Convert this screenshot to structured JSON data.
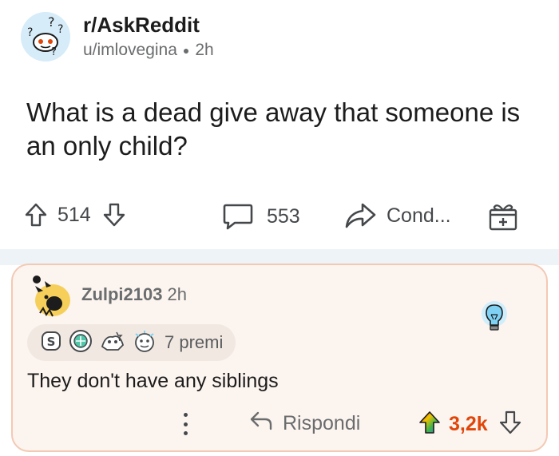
{
  "post": {
    "subreddit": "r/AskReddit",
    "author": "u/imlovegina",
    "time": "2h",
    "title": "What is a dead give away that someone is an only child?",
    "actions": {
      "upvote_icon": "arrow-up-icon",
      "score": "514",
      "downvote_icon": "arrow-down-icon",
      "comment_icon": "chat-bubble-icon",
      "comment_count": "553",
      "share_icon": "share-arrow-icon",
      "share_label": "Cond...",
      "award_icon": "gift-box-icon"
    }
  },
  "comment": {
    "author": "Zulpi2103",
    "time": "2h",
    "awards_label": "7 premi",
    "body": "They don't have any siblings",
    "reply_label": "Rispondi",
    "score": "3,2k",
    "score_color": "#e0460a"
  },
  "colors": {
    "card_background": "#fcf4ef",
    "card_border": "#f3c9b4",
    "separator": "#edf3f7",
    "upvote_accent": "#e0460a"
  }
}
